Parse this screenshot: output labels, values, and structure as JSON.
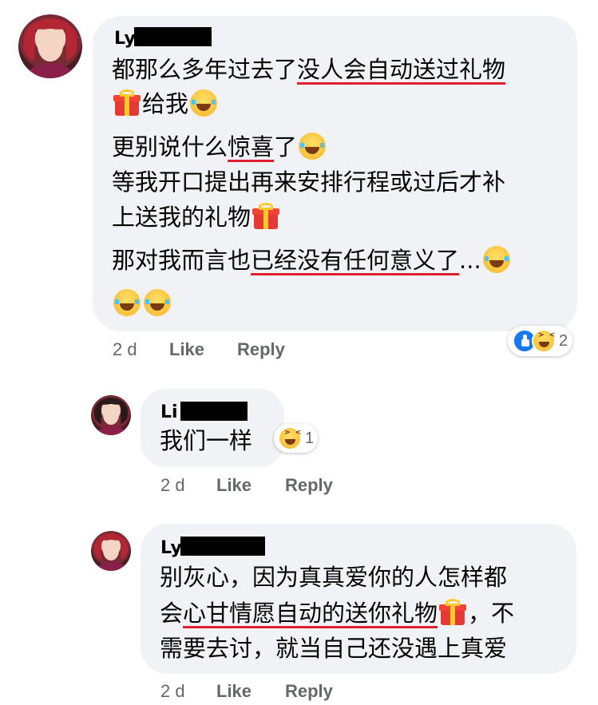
{
  "comments": [
    {
      "author": "Ly",
      "lines": [
        [
          "都那么多年过去了",
          "没人会自动送过礼物"
        ],
        [
          "给我"
        ],
        [
          "更别说什么",
          "惊喜",
          "了"
        ],
        [
          "等我开口提出再来安排行程或过后才补"
        ],
        [
          "上送我的礼物"
        ],
        [
          "那对我而言也",
          "已经没有任何意义了",
          "..."
        ]
      ],
      "time": "2 d",
      "like_label": "Like",
      "reply_label": "Reply",
      "reaction_count": "2"
    },
    {
      "author": "Li",
      "text": "我们一样",
      "time": "2 d",
      "like_label": "Like",
      "reply_label": "Reply",
      "reaction_count": "1"
    },
    {
      "author": "Ly",
      "lines": [
        [
          "别灰心，因为真真爱你的人怎样都"
        ],
        [
          "会",
          "心甘情愿自动的送你礼物",
          "，不"
        ],
        [
          "需要去讨，就当自己还没遇上真爱"
        ]
      ],
      "time": "2 d",
      "like_label": "Like",
      "reply_label": "Reply"
    }
  ],
  "icons": {
    "gift": "gift-emoji-icon",
    "laugh": "tears-of-joy-emoji-icon",
    "like_reaction": "like-reaction-icon",
    "haha_reaction": "haha-reaction-icon"
  }
}
